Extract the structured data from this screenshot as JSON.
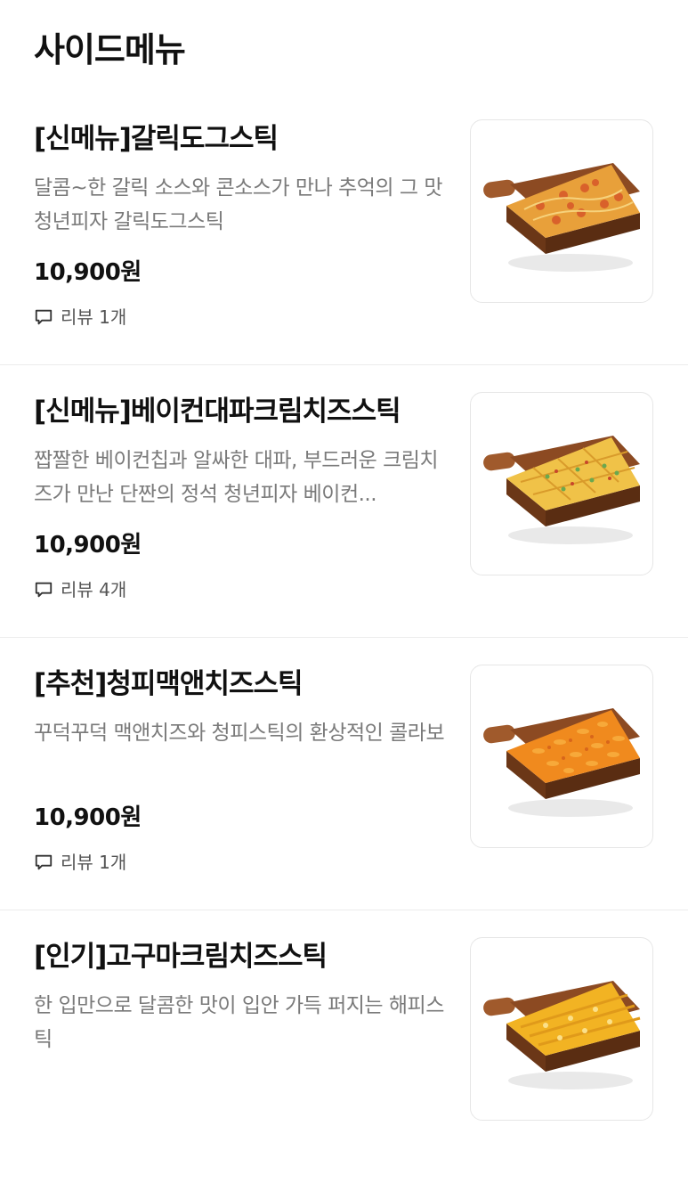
{
  "section": {
    "title": "사이드메뉴"
  },
  "items": [
    {
      "name": "[신메뉴]갈릭도그스틱",
      "description": "달콤~한 갈릭 소스와 콘소스가 만나 추억의 그 맛 청년피자 갈릭도그스틱",
      "price": "10,900원",
      "review": "리뷰 1개",
      "image": "garlic-dog-stick-photo",
      "topping_color": "#e8a03a"
    },
    {
      "name": "[신메뉴]베이컨대파크림치즈스틱",
      "description": "짭짤한 베이컨칩과 알싸한 대파, 부드러운 크림치즈가 만난 단짠의 정석 청년피자 베이컨...",
      "price": "10,900원",
      "review": "리뷰 4개",
      "image": "bacon-green-onion-cream-cheese-stick-photo",
      "topping_color": "#f0c248"
    },
    {
      "name": "[추천]청피맥앤치즈스틱",
      "description": "꾸덕꾸덕 맥앤치즈와 청피스틱의 환상적인 콜라보",
      "price": "10,900원",
      "review": "리뷰 1개",
      "image": "mac-and-cheese-stick-photo",
      "topping_color": "#f08a1e"
    },
    {
      "name": "[인기]고구마크림치즈스틱",
      "description": "한 입만으로 달콤한 맛이 입안 가득 퍼지는 해피스틱",
      "price": "",
      "review": "",
      "image": "sweet-potato-cream-cheese-stick-photo",
      "topping_color": "#f2b323"
    }
  ]
}
